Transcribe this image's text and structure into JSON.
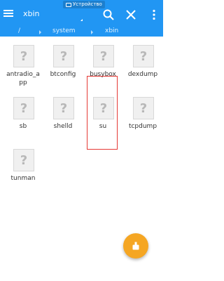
{
  "status_bar": {
    "device_label": "Устройство"
  },
  "header": {
    "title": "xbin",
    "actions": [
      {
        "icon": "search-icon"
      },
      {
        "icon": "close-icon"
      },
      {
        "icon": "more-vert-icon"
      }
    ]
  },
  "breadcrumb": {
    "root": "/",
    "system": "system",
    "xbin": "xbin"
  },
  "files": [
    {
      "name": "antradio_app",
      "line1": "antradio_a",
      "line2": "pp"
    },
    {
      "name": "btconfig",
      "line1": "btconfig",
      "line2": ""
    },
    {
      "name": "busybox",
      "line1": "busybox",
      "line2": ""
    },
    {
      "name": "dexdump",
      "line1": "dexdump",
      "line2": ""
    },
    {
      "name": "sb",
      "line1": "sb",
      "line2": ""
    },
    {
      "name": "shelld",
      "line1": "shelld",
      "line2": ""
    },
    {
      "name": "su",
      "line1": "su",
      "line2": ""
    },
    {
      "name": "tcpdump",
      "line1": "tcpdump",
      "line2": ""
    },
    {
      "name": "tunman",
      "line1": "tunman",
      "line2": ""
    }
  ],
  "thumb_glyph": "?",
  "colors": {
    "app_bar": "#2196f3",
    "highlight": "#e53935",
    "fab": "#f5a623"
  },
  "fab": {
    "icon": "clean-brush-icon"
  }
}
